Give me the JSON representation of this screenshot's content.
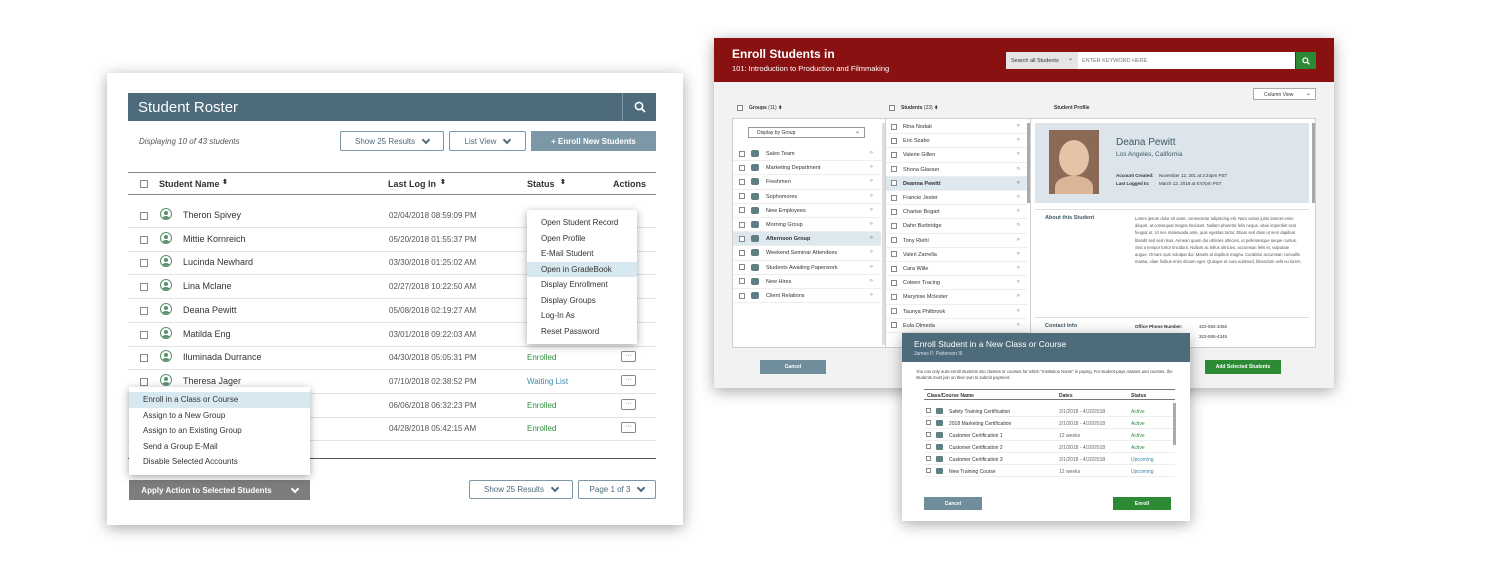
{
  "roster": {
    "title": "Student Roster",
    "displaying": "Displaying 10 of 43 students",
    "show_results": "Show 25 Results",
    "view": "List View",
    "enroll_new": "+ Enroll New Students",
    "columns": {
      "name": "Student Name",
      "last_login": "Last Log In",
      "status": "Status",
      "actions": "Actions"
    },
    "rows": [
      {
        "name": "Theron Spivey",
        "date": "02/04/2018 08:59:09 PM",
        "status": ""
      },
      {
        "name": "Mittie Kornreich",
        "date": "05/20/2018 01:55:37 PM",
        "status": ""
      },
      {
        "name": "Lucinda Newhard",
        "date": "03/30/2018 01:25:02 AM",
        "status": ""
      },
      {
        "name": "Lina Mclane",
        "date": "02/27/2018 10:22:50 AM",
        "status": ""
      },
      {
        "name": "Deana Pewitt",
        "date": "05/08/2018 02:19:27 AM",
        "status": ""
      },
      {
        "name": "Matilda Eng",
        "date": "03/01/2018 09:22:03 AM",
        "status": ""
      },
      {
        "name": "Iluminada Durrance",
        "date": "04/30/2018 05:05:31 PM",
        "status": "Enrolled"
      },
      {
        "name": "Theresa Jager",
        "date": "07/10/2018 02:38:52 PM",
        "status": "Waiting List"
      },
      {
        "name": "",
        "date": "06/06/2018 06:32:23 PM",
        "status": "Enrolled"
      },
      {
        "name": "",
        "date": "04/28/2018 05:42:15 AM",
        "status": "Enrolled"
      }
    ],
    "row_menu": [
      "Open Student Record",
      "Open Profile",
      "E-Mail Student",
      "Open in GradeBook",
      "Display Enrollment",
      "Display Groups",
      "Log-In As",
      "Reset Password"
    ],
    "action_menu": [
      "Enroll in a Class or Course",
      "Assign to a New Group",
      "Assign to an Existing Group",
      "Send a Group E-Mail",
      "Disable Selected Accounts"
    ],
    "apply_action": "Apply Action to Selected Students",
    "footer_show": "Show 25 Results",
    "page": "Page 1 of 3",
    "dots": "···",
    "status_colors": {
      "Enrolled": "#2e8b3a",
      "Waiting List": "#3a8aa8"
    }
  },
  "enroll": {
    "title": "Enroll Students in",
    "subtitle": "101: Introduction to Production and Filmmaking",
    "search_scope": "Search all Students",
    "search_placeholder": "ENTER KEYWORD HERE",
    "column_view": "Column View",
    "groups_label": "Groups",
    "groups_count": "(11)",
    "students_label": "Students",
    "students_count": "(23)",
    "profile_label": "Student Profile",
    "display_by": "Display by Group",
    "groups": [
      "Sales Team",
      "Marketing Department",
      "Freshmen",
      "Sophomores",
      "New Employees",
      "Morning Group",
      "Afternoon Group",
      "Weekend Seminar Attendees",
      "Students Awaiting Paperwork",
      "New Hires",
      "Client Relations"
    ],
    "students": [
      "Rina Nodati",
      "Eric Szabo",
      "Valerie Gillen",
      "Shona Glasser",
      "Deanna Pewitt",
      "Francie Jester",
      "Charise Bogart",
      "Dahn Burbridge",
      "Tony Riehl",
      "Valeri Zarrella",
      "Cara Wille",
      "Coleen Tracing",
      "Marynise Mclester",
      "Taunya Philbrook",
      "Eula Olmeda"
    ],
    "profile": {
      "name": "Deana Pewitt",
      "location": "Los Angeles, California",
      "created_label": "Account Created:",
      "created": "November 12, 201 at 2:24pm PST",
      "logged_label": "Last Logged In:",
      "logged": "March 12, 2018 at 6:57pm PST",
      "about_label": "About this Student",
      "about_text": "Lorem ipsum dolor sit amet, consectetur adipiscing elit. Nam varius justo laoreet enim aliquet, at consequat magna tincidunt. Nullam pharetra felis neque, vitae imperdiet erat feugiat ut. Ut nec malesuada ante, quis egestas tortor. Etiam sed diam ut sem dapibus blandit sed sed risus. Aenean quam dui ultricies ultricies, ut pellentesque neque cursus. Sed a tempor tortor tincidunt. Nullam ac tellus ultricies, accumsan felis et, vulputate augue. Ornare quis volutpat dui. Mauris at dapibus magna. Curabitur accumsan convallis massa, vitae finibus enim dictum eget. Quisque et cura euismod, bibendum velit eu lorem.",
      "contact_label": "Contact Info",
      "office_label": "Office Phone Number:",
      "office": "323-555-3456",
      "mobile": "323-555-4345"
    },
    "cancel": "Cancel",
    "add": "Add Selected Students"
  },
  "course_modal": {
    "title": "Enroll Student in a New Class or Course",
    "subtitle": "James P. Patterson III",
    "note": "You can only auto-enroll students into classes or courses for which \"Institution Name\" is paying. For student-pays classes and courses, the students must join on their own to submit payment.",
    "columns": {
      "name": "Class/Course Name",
      "dates": "Dates",
      "status": "Status"
    },
    "rows": [
      {
        "name": "Safety Training Certification",
        "dates": "2/1/2018 - 4/20/2018",
        "status": "Active"
      },
      {
        "name": "2018 Marketing Certification",
        "dates": "2/1/2018 - 4/20/2018",
        "status": "Active"
      },
      {
        "name": "Customer Certification 1",
        "dates": "12 weeks",
        "status": "Active"
      },
      {
        "name": "Customer Certification 2",
        "dates": "2/1/2018 - 4/20/2018",
        "status": "Active"
      },
      {
        "name": "Customer Certification 3",
        "dates": "2/1/2018 - 4/20/2018",
        "status": "Upcoming"
      },
      {
        "name": "New Training Course",
        "dates": "12 weeks",
        "status": "Upcoming"
      }
    ],
    "cancel": "Cancel",
    "enroll": "Enroll"
  }
}
